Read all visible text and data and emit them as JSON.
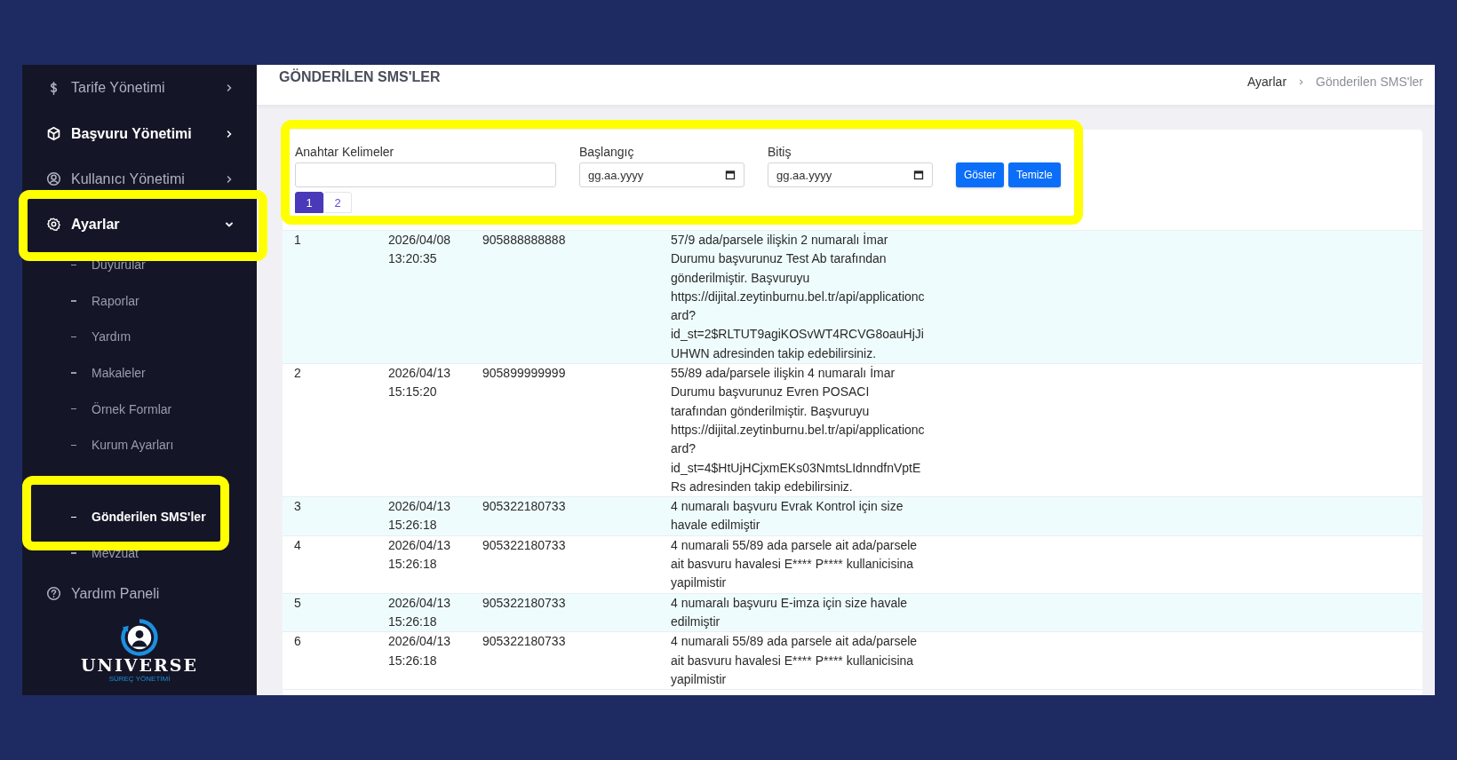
{
  "sidebar": {
    "items": [
      {
        "label": "Tarife Yönetimi",
        "emphasized": false,
        "expandable": true,
        "expanded": false
      },
      {
        "label": "Başvuru Yönetimi",
        "emphasized": true,
        "expandable": true,
        "expanded": false
      },
      {
        "label": "Kullanıcı Yönetimi",
        "emphasized": false,
        "expandable": true,
        "expanded": false
      },
      {
        "label": "Ayarlar",
        "emphasized": true,
        "expandable": true,
        "expanded": true,
        "children": [
          {
            "label": "Duyurular",
            "selected": false
          },
          {
            "label": "Raporlar",
            "selected": false
          },
          {
            "label": "Yardım",
            "selected": false
          },
          {
            "label": "Makaleler",
            "selected": false
          },
          {
            "label": "Örnek Formlar",
            "selected": false
          },
          {
            "label": "Kurum Ayarları",
            "selected": false
          },
          {
            "label": "Gönderilen SMS'ler",
            "selected": true
          },
          {
            "label": "Mevzuat",
            "selected": false
          }
        ]
      },
      {
        "label": "Yardım Paneli",
        "emphasized": false,
        "expandable": false,
        "expanded": false
      }
    ],
    "logo": {
      "name": "UNIVERSE",
      "tagline": "SÜREÇ YÖNETİMİ"
    }
  },
  "page": {
    "title": "GÖNDERİLEN SMS'LER",
    "breadcrumb": [
      "Ayarlar",
      "Gönderilen SMS'ler"
    ]
  },
  "filter": {
    "keyword_label": "Anahtar Kelimeler",
    "start_label": "Başlangıç",
    "start_placeholder": "gg.aa.yyyy",
    "end_label": "Bitiş",
    "end_placeholder": "gg.aa.yyyy",
    "buttons": [
      "Göster",
      "Temizle"
    ]
  },
  "pagination": [
    {
      "label": "1",
      "selected": true
    },
    {
      "label": "2",
      "selected": false
    }
  ],
  "table": {
    "rows": [
      {
        "no": "1",
        "date": "2026/04/08",
        "time": "13:20:35",
        "phone": "905888888888",
        "message": "57/9 ada/parsele ilişkin 2 numaralı İmar Durumu başvurunuz Test Ab tarafından gönderilmiştir. Başvuruyu https://dijital.zeytinburnu.bel.tr/api/applicationcard?id_st=2$RLTUT9agiKOSvWT4RCVG8oauHjJiUHWN adresinden takip edebilirsiniz."
      },
      {
        "no": "2",
        "date": "2026/04/13",
        "time": "15:15:20",
        "phone": "905899999999",
        "message": "55/89 ada/parsele ilişkin 4 numaralı İmar Durumu başvurunuz Evren POSACI tarafından gönderilmiştir. Başvuruyu https://dijital.zeytinburnu.bel.tr/api/applicationcard?id_st=4$HtUjHCjxmEKs03NmtsLIdnndfnVptERs adresinden takip edebilirsiniz."
      },
      {
        "no": "3",
        "date": "2026/04/13",
        "time": "15:26:18",
        "phone": "905322180733",
        "message": "4 numaralı başvuru Evrak Kontrol için size havale edilmiştir"
      },
      {
        "no": "4",
        "date": "2026/04/13",
        "time": "15:26:18",
        "phone": "905322180733",
        "message": "4 numarali 55/89 ada parsele ait ada/parsele ait basvuru havalesi E**** P**** kullanicisina yapilmistir"
      },
      {
        "no": "5",
        "date": "2026/04/13",
        "time": "15:26:18",
        "phone": "905322180733",
        "message": "4 numaralı başvuru E-imza için size havale edilmiştir"
      },
      {
        "no": "6",
        "date": "2026/04/13",
        "time": "15:26:18",
        "phone": "905322180733",
        "message": "4 numarali 55/89 ada parsele ait ada/parsele ait basvuru havalesi E**** P**** kullanicisina yapilmistir"
      }
    ]
  }
}
